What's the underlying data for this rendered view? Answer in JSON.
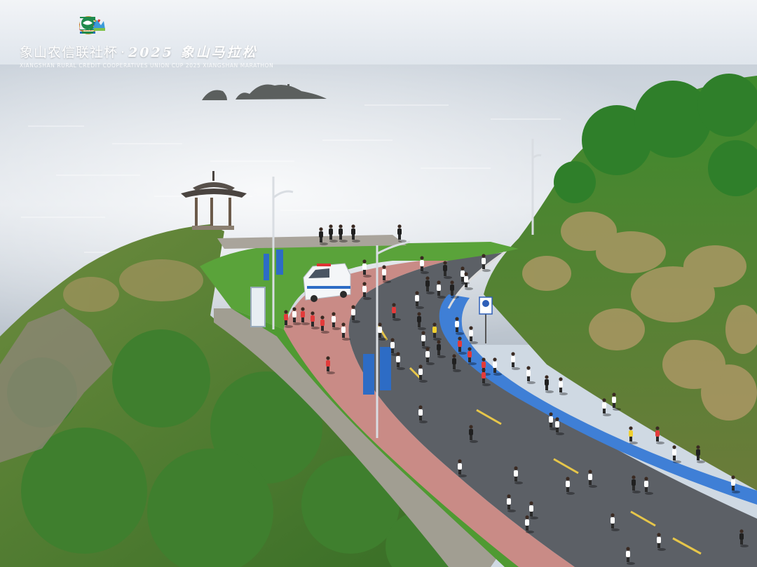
{
  "header": {
    "title_cn": "象山农信联社杯",
    "separator": "·",
    "event_cn": "2025 象山马拉松",
    "subtitle_en": "XIANGSHAN RURAL CREDIT COOPERATIVES UNION CUP 2025 XIANGSHAN MARATHON",
    "logos": [
      "xiangshan-emblem-icon",
      "china-athletics-icon",
      "xiangshan-tourism-icon",
      "sponsor-icon",
      "rural-credit-icon"
    ]
  },
  "colors": {
    "sky": "#dde6ee",
    "sea": "#c3ccd6",
    "road": "#5c6066",
    "blue_lane": "#3f7fd6",
    "sidewalk": "#c98b86",
    "grass": "#5aa33a",
    "foliage": "#3e7a2e",
    "wall": "#8c8676"
  }
}
